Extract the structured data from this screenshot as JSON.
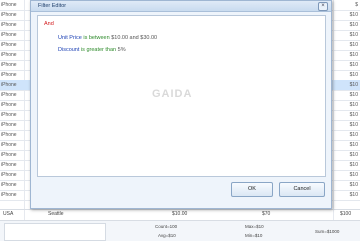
{
  "background": {
    "rows": [
      {
        "left": "iPhone",
        "right": "$",
        "selected": false
      },
      {
        "left": "iPhone",
        "right": "$10",
        "selected": false
      },
      {
        "left": "iPhone",
        "right": "$10",
        "selected": false
      },
      {
        "left": "iPhone",
        "right": "$10",
        "selected": false
      },
      {
        "left": "iPhone",
        "right": "$10",
        "selected": false
      },
      {
        "left": "iPhone",
        "right": "$10",
        "selected": false
      },
      {
        "left": "iPhone",
        "right": "$10",
        "selected": false
      },
      {
        "left": "iPhone",
        "right": "$10",
        "selected": false
      },
      {
        "left": "iPhone",
        "right": "$10",
        "selected": true
      },
      {
        "left": "iPhone",
        "right": "$10",
        "selected": false
      },
      {
        "left": "iPhone",
        "right": "$10",
        "selected": false
      },
      {
        "left": "iPhone",
        "right": "$10",
        "selected": false
      },
      {
        "left": "iPhone",
        "right": "$10",
        "selected": false
      },
      {
        "left": "iPhone",
        "right": "$10",
        "selected": false
      },
      {
        "left": "iPhone",
        "right": "$10",
        "selected": false
      },
      {
        "left": "iPhone",
        "right": "$10",
        "selected": false
      },
      {
        "left": "iPhone",
        "right": "$10",
        "selected": false
      },
      {
        "left": "iPhone",
        "right": "$10",
        "selected": false
      },
      {
        "left": "iPhone",
        "right": "$10",
        "selected": false
      },
      {
        "left": "iPhone",
        "right": "$10",
        "selected": false
      }
    ],
    "bottom_row": {
      "col1": "USA",
      "col2": "Seattle",
      "col3": "$10.00",
      "col4": "$70",
      "col5": "$100"
    },
    "summary": {
      "count": "Count=100",
      "avg": "Avg=$10",
      "max": "Max=$10",
      "min": "Min=$10",
      "sum": "Sum=$1000"
    }
  },
  "dialog": {
    "title": "Filter Editor",
    "close_label": "×",
    "filter": {
      "group_operator": "And",
      "conditions": [
        {
          "field": "Unit Price",
          "operator": "is between",
          "value": "$10.00 and $30.00"
        },
        {
          "field": "Discount",
          "operator": "is greater than",
          "value": "5%"
        }
      ]
    },
    "watermark": "GAIDA",
    "ok_label": "OK",
    "cancel_label": "Cancel"
  }
}
